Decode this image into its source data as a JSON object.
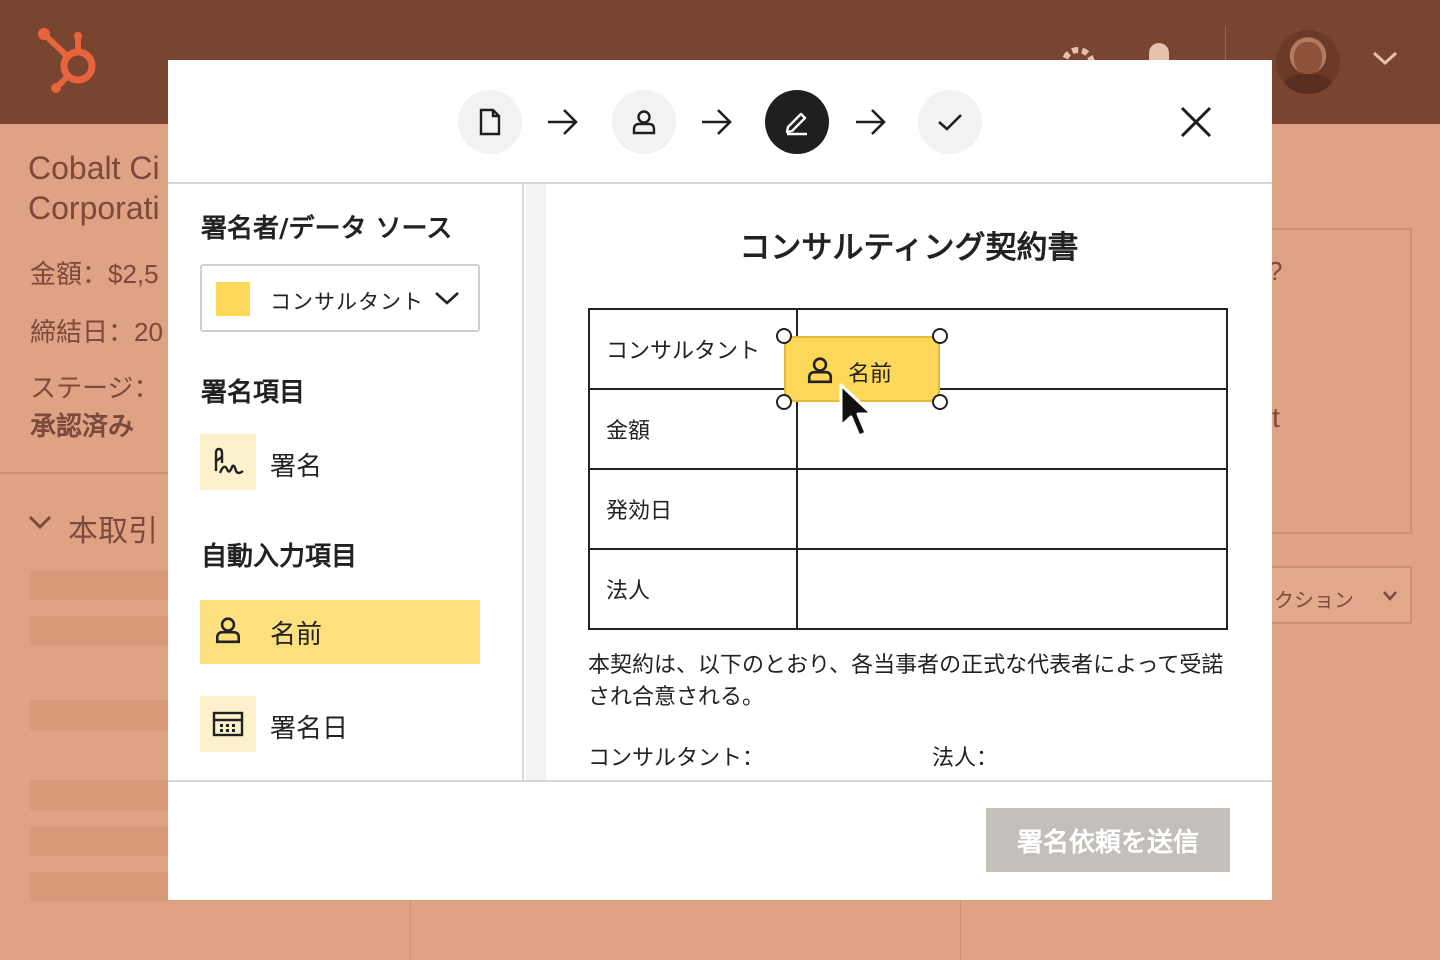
{
  "background": {
    "company_line1": "Cobalt Ci",
    "company_line2": "Corporati",
    "amount_label": "金額：$2,5",
    "close_date_label": "締結日：20",
    "stage_label": "ステージ：",
    "stage_value": "承認済み",
    "section_title": "本取引",
    "right_card_text": "t",
    "right_card_mark": "?",
    "action_button": "クション"
  },
  "modal": {
    "steps": [
      {
        "icon": "document-icon",
        "active": false
      },
      {
        "icon": "person-icon",
        "active": false
      },
      {
        "icon": "pencil-icon",
        "active": true
      },
      {
        "icon": "check-icon",
        "active": false
      }
    ],
    "sidebar": {
      "signer_heading": "署名者/データ ソース",
      "signer_select_value": "コンサルタント",
      "signer_color": "#fdd858",
      "signature_heading": "署名項目",
      "signature_item": "署名",
      "autofill_heading": "自動入力項目",
      "autofill_items": [
        "名前",
        "署名日"
      ]
    },
    "document": {
      "title": "コンサルティング契約書",
      "rows": [
        "コンサルタント",
        "金額",
        "発効日",
        "法人"
      ],
      "paragraph": "本契約は、以下のとおり、各当事者の正式な代表者によって受諾され合意される。",
      "signature_consultant": "コンサルタント：",
      "signature_entity": "法人："
    },
    "dragged_field_label": "名前",
    "send_button": "署名依頼を送信"
  },
  "colors": {
    "topbar": "#7a4530",
    "accent_yellow": "#fdd858",
    "active_step": "#1f1f1f",
    "disabled_button": "#c3bfba"
  }
}
